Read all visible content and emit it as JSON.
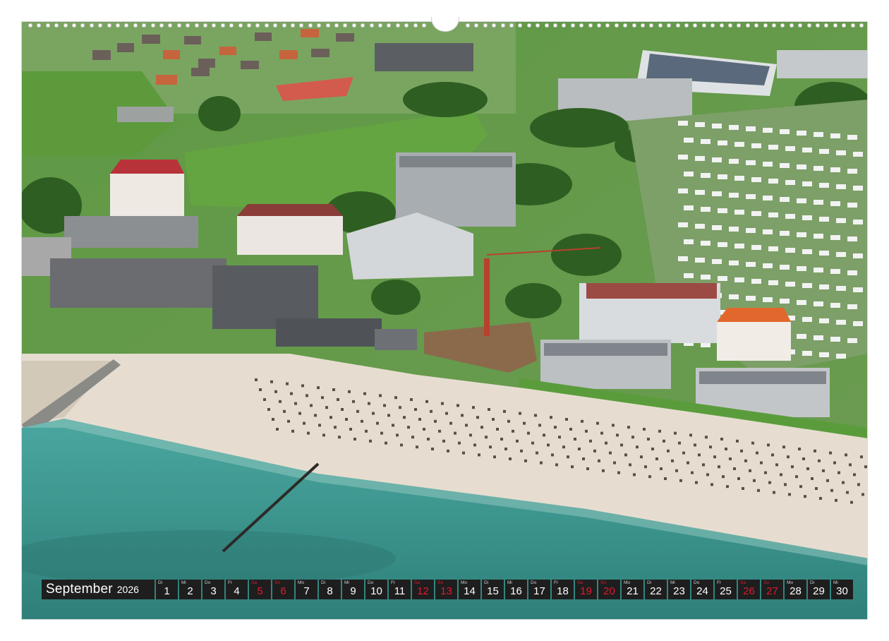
{
  "calendar": {
    "month": "September",
    "year": "2026",
    "days": [
      {
        "wd": "Di",
        "n": "1",
        "weekend": false
      },
      {
        "wd": "Mi",
        "n": "2",
        "weekend": false
      },
      {
        "wd": "Do",
        "n": "3",
        "weekend": false
      },
      {
        "wd": "Fr",
        "n": "4",
        "weekend": false
      },
      {
        "wd": "Sa",
        "n": "5",
        "weekend": true
      },
      {
        "wd": "So",
        "n": "6",
        "weekend": true
      },
      {
        "wd": "Mo",
        "n": "7",
        "weekend": false
      },
      {
        "wd": "Di",
        "n": "8",
        "weekend": false
      },
      {
        "wd": "Mi",
        "n": "9",
        "weekend": false
      },
      {
        "wd": "Do",
        "n": "10",
        "weekend": false
      },
      {
        "wd": "Fr",
        "n": "11",
        "weekend": false
      },
      {
        "wd": "Sa",
        "n": "12",
        "weekend": true
      },
      {
        "wd": "So",
        "n": "13",
        "weekend": true
      },
      {
        "wd": "Mo",
        "n": "14",
        "weekend": false
      },
      {
        "wd": "Di",
        "n": "15",
        "weekend": false
      },
      {
        "wd": "Mi",
        "n": "16",
        "weekend": false
      },
      {
        "wd": "Do",
        "n": "17",
        "weekend": false
      },
      {
        "wd": "Fr",
        "n": "18",
        "weekend": false
      },
      {
        "wd": "Sa",
        "n": "19",
        "weekend": true
      },
      {
        "wd": "So",
        "n": "20",
        "weekend": true
      },
      {
        "wd": "Mo",
        "n": "21",
        "weekend": false
      },
      {
        "wd": "Di",
        "n": "22",
        "weekend": false
      },
      {
        "wd": "Mi",
        "n": "23",
        "weekend": false
      },
      {
        "wd": "Do",
        "n": "24",
        "weekend": false
      },
      {
        "wd": "Fr",
        "n": "25",
        "weekend": false
      },
      {
        "wd": "Sa",
        "n": "26",
        "weekend": true
      },
      {
        "wd": "So",
        "n": "27",
        "weekend": true
      },
      {
        "wd": "Mo",
        "n": "28",
        "weekend": false
      },
      {
        "wd": "Di",
        "n": "29",
        "weekend": false
      },
      {
        "wd": "Mi",
        "n": "30",
        "weekend": false
      }
    ]
  },
  "colors": {
    "strip_background": "#1e1e1e",
    "weekday_text": "#ffffff",
    "weekend_text": "#e0192e",
    "sea": "#3f9a93",
    "sand": "#e6ddd0",
    "grass": "#4f8f3a"
  },
  "photo": {
    "subject": "aerial-view-beach-town"
  }
}
